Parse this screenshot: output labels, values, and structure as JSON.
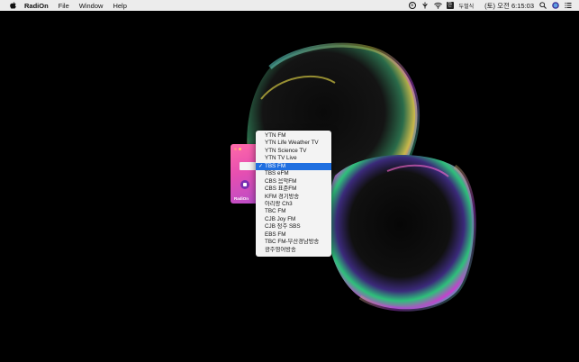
{
  "menubar": {
    "app_name": "RadiOn",
    "menus": [
      "File",
      "Window",
      "Help"
    ],
    "ime_label": "두벌식",
    "clock": "(토) 오전 6:15:03",
    "input_badge": "한"
  },
  "app_window": {
    "logo": "RadiOn"
  },
  "dropdown": {
    "selected": "TBS FM",
    "check_mark": "✓",
    "items": [
      "YTN FM",
      "YTN Life Weather TV",
      "YTN Science TV",
      "YTN TV Live",
      "TBS FM",
      "TBS eFM",
      "CBS 음악FM",
      "CBS 표준FM",
      "KFM 경기방송",
      "아리랑 Ch3",
      "TBC FM",
      "CJB Joy FM",
      "CJB 청주 SBS",
      "EBS FM",
      "TBC FM-부산경남방송",
      "광주영어방송"
    ]
  },
  "colors": {
    "menubar_bg": "#ececec",
    "selection": "#1f6fe0",
    "app_gradient_start": "#ff6aa8",
    "app_gradient_end": "#b94cc9"
  }
}
